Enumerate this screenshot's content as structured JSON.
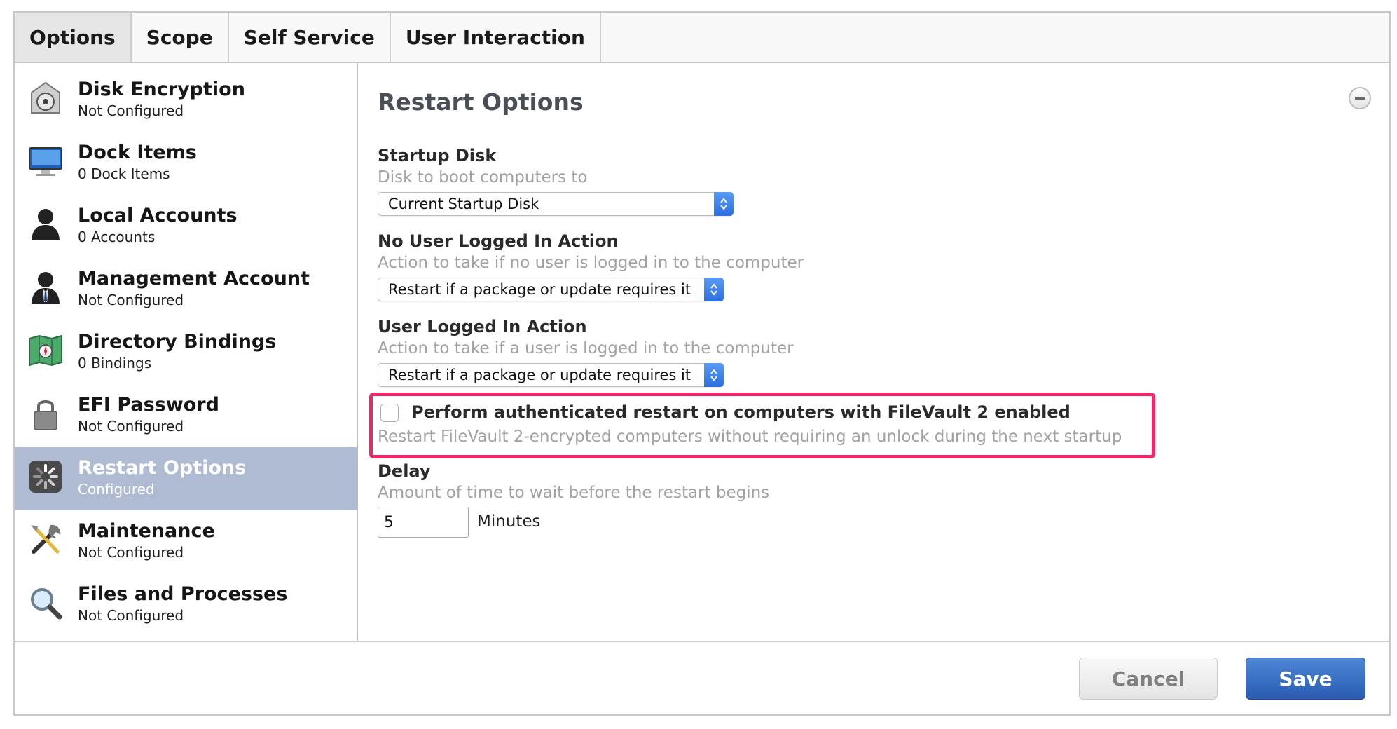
{
  "tabs": [
    {
      "label": "Options",
      "active": true
    },
    {
      "label": "Scope",
      "active": false
    },
    {
      "label": "Self Service",
      "active": false
    },
    {
      "label": "User Interaction",
      "active": false
    }
  ],
  "sidebar": {
    "items": [
      {
        "title": "Disk Encryption",
        "subtitle": "Not Configured",
        "icon": "disk-encryption-icon"
      },
      {
        "title": "Dock Items",
        "subtitle": "0 Dock Items",
        "icon": "monitor-icon"
      },
      {
        "title": "Local Accounts",
        "subtitle": "0 Accounts",
        "icon": "user-silhouette-icon"
      },
      {
        "title": "Management Account",
        "subtitle": "Not Configured",
        "icon": "admin-user-icon"
      },
      {
        "title": "Directory Bindings",
        "subtitle": "0 Bindings",
        "icon": "directory-map-icon"
      },
      {
        "title": "EFI Password",
        "subtitle": "Not Configured",
        "icon": "lock-icon"
      },
      {
        "title": "Restart Options",
        "subtitle": "Configured",
        "icon": "restart-spinner-icon",
        "selected": true
      },
      {
        "title": "Maintenance",
        "subtitle": "Not Configured",
        "icon": "tools-icon"
      },
      {
        "title": "Files and Processes",
        "subtitle": "Not Configured",
        "icon": "magnifier-icon"
      }
    ]
  },
  "main": {
    "title": "Restart Options",
    "startup_disk": {
      "label": "Startup Disk",
      "help": "Disk to boot computers to",
      "value": "Current Startup Disk"
    },
    "no_user_action": {
      "label": "No User Logged In Action",
      "help": "Action to take if no user is logged in to the computer",
      "value": "Restart if a package or update requires it"
    },
    "user_action": {
      "label": "User Logged In Action",
      "help": "Action to take if a user is logged in to the computer",
      "value": "Restart if a package or update requires it"
    },
    "filevault": {
      "label": "Perform authenticated restart on computers with FileVault 2 enabled",
      "help": "Restart FileVault 2-encrypted computers without requiring an unlock during the next startup",
      "checked": false
    },
    "delay": {
      "label": "Delay",
      "help": "Amount of time to wait before the restart begins",
      "value": "5",
      "unit": "Minutes"
    }
  },
  "footer": {
    "cancel_label": "Cancel",
    "save_label": "Save"
  },
  "colors": {
    "selected_row": "#aebbd2",
    "highlight_border": "#f0286a",
    "save_button": "#2a5cb2",
    "select_arrow": "#2d6fe0"
  }
}
